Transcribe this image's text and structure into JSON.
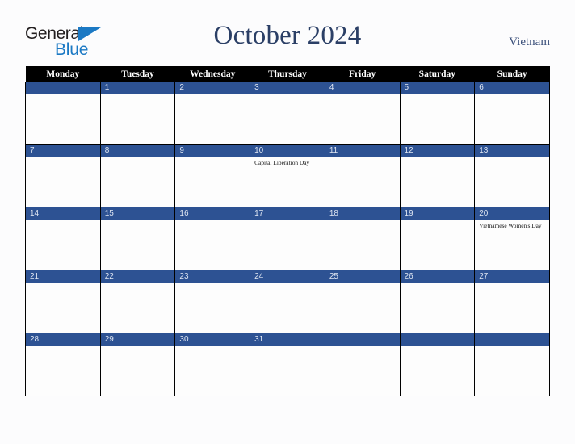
{
  "brand": {
    "name_part1": "General",
    "name_part2": "Blue",
    "triangle_color": "#1b79c4",
    "text_color": "#231f20"
  },
  "header": {
    "title": "October 2024",
    "country": "Vietnam",
    "title_color": "#2b3f66"
  },
  "calendar": {
    "weekday_headers": [
      "Monday",
      "Tuesday",
      "Wednesday",
      "Thursday",
      "Friday",
      "Saturday",
      "Sunday"
    ],
    "header_bg": "#000000",
    "daybar_bg": "#2d5293",
    "weeks": [
      [
        {
          "day": "",
          "event": ""
        },
        {
          "day": "1",
          "event": ""
        },
        {
          "day": "2",
          "event": ""
        },
        {
          "day": "3",
          "event": ""
        },
        {
          "day": "4",
          "event": ""
        },
        {
          "day": "5",
          "event": ""
        },
        {
          "day": "6",
          "event": ""
        }
      ],
      [
        {
          "day": "7",
          "event": ""
        },
        {
          "day": "8",
          "event": ""
        },
        {
          "day": "9",
          "event": ""
        },
        {
          "day": "10",
          "event": "Capital Liberation Day"
        },
        {
          "day": "11",
          "event": ""
        },
        {
          "day": "12",
          "event": ""
        },
        {
          "day": "13",
          "event": ""
        }
      ],
      [
        {
          "day": "14",
          "event": ""
        },
        {
          "day": "15",
          "event": ""
        },
        {
          "day": "16",
          "event": ""
        },
        {
          "day": "17",
          "event": ""
        },
        {
          "day": "18",
          "event": ""
        },
        {
          "day": "19",
          "event": ""
        },
        {
          "day": "20",
          "event": "Vietnamese Women's Day"
        }
      ],
      [
        {
          "day": "21",
          "event": ""
        },
        {
          "day": "22",
          "event": ""
        },
        {
          "day": "23",
          "event": ""
        },
        {
          "day": "24",
          "event": ""
        },
        {
          "day": "25",
          "event": ""
        },
        {
          "day": "26",
          "event": ""
        },
        {
          "day": "27",
          "event": ""
        }
      ],
      [
        {
          "day": "28",
          "event": ""
        },
        {
          "day": "29",
          "event": ""
        },
        {
          "day": "30",
          "event": ""
        },
        {
          "day": "31",
          "event": ""
        },
        {
          "day": "",
          "event": ""
        },
        {
          "day": "",
          "event": ""
        },
        {
          "day": "",
          "event": ""
        }
      ]
    ]
  }
}
